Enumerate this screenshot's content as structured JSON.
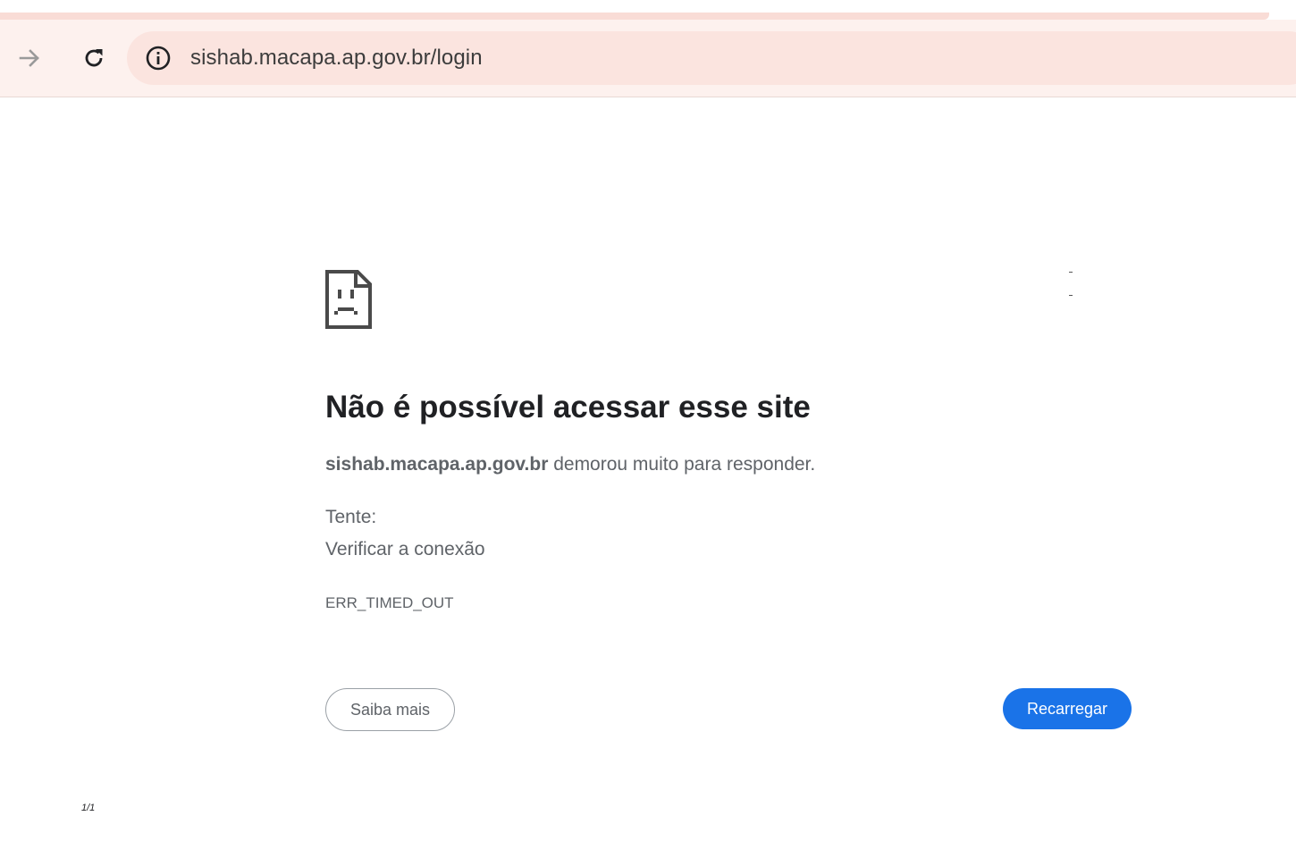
{
  "browser": {
    "url": "sishab.macapa.ap.gov.br/login",
    "forward_icon": "arrow-right-icon",
    "reload_icon": "reload-icon",
    "site_info_icon": "info-circle-icon"
  },
  "error": {
    "icon": "sad-document-icon",
    "title": "Não é possível acessar esse site",
    "host": "sishab.macapa.ap.gov.br",
    "summary_rest": " demorou muito para responder.",
    "try_label": "Tente:",
    "suggestion": "Verificar a conexão",
    "code": "ERR_TIMED_OUT",
    "details_button": "Saiba mais",
    "reload_button": "Recarregar"
  },
  "footer": {
    "page_counter": "1/1"
  },
  "colors": {
    "toolbar_bg": "#fdf1ee",
    "omnibox_bg": "#fbe4df",
    "primary_button": "#1a73e8",
    "title_text": "#202124",
    "body_text": "#5f6368"
  }
}
